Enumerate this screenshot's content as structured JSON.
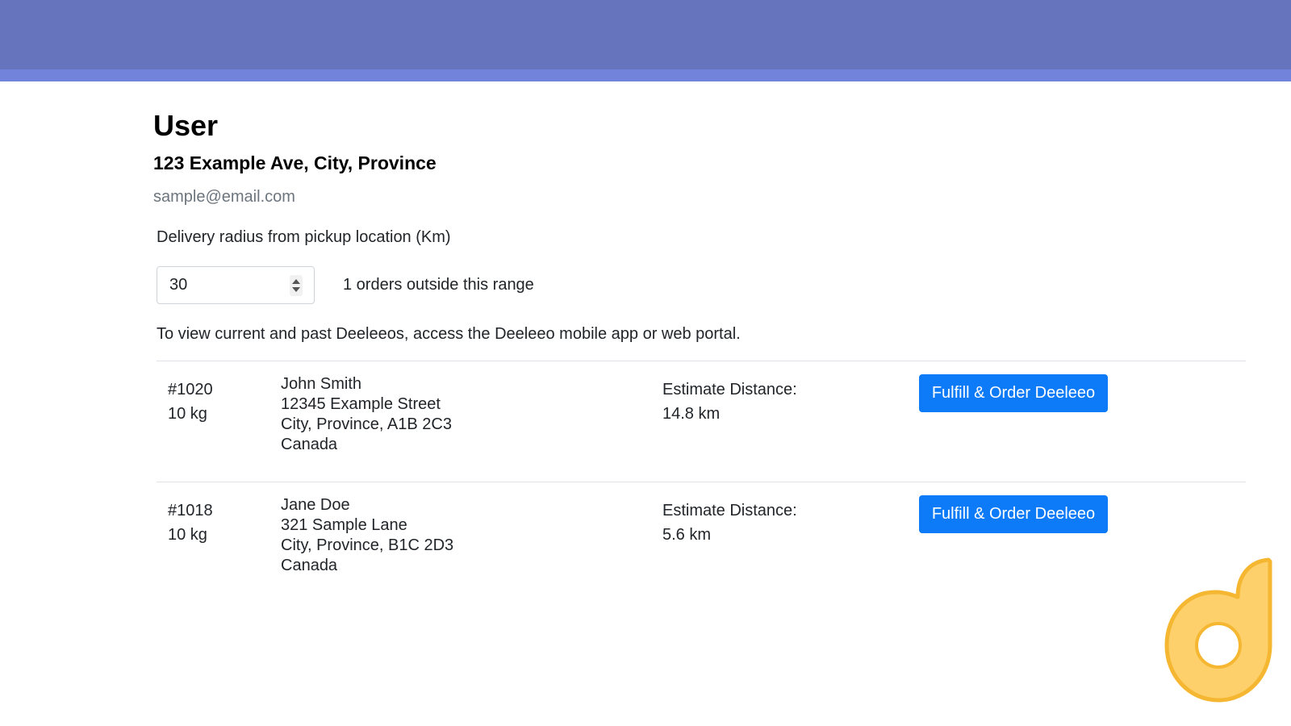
{
  "user": {
    "title": "User",
    "address": "123 Example Ave, City, Province",
    "email": "sample@email.com"
  },
  "delivery": {
    "radius_label": "Delivery radius from pickup location (Km)",
    "radius_value": "30",
    "outside_range_text": "1 orders outside this range",
    "info_text": "To view current and past Deeleeos, access the Deeleeo mobile app or web portal."
  },
  "orders": [
    {
      "id": "#1020",
      "weight": "10 kg",
      "name": "John Smith",
      "street": "12345 Example Street",
      "city_line": "City, Province, A1B 2C3",
      "country": "Canada",
      "distance_label": "Estimate Distance:",
      "distance_value": "14.8 km",
      "button_label": "Fulfill & Order Deeleeo"
    },
    {
      "id": "#1018",
      "weight": "10 kg",
      "name": "Jane Doe",
      "street": "321 Sample Lane",
      "city_line": "City, Province, B1C 2D3",
      "country": "Canada",
      "distance_label": "Estimate Distance:",
      "distance_value": "5.6 km",
      "button_label": "Fulfill & Order Deeleeo"
    }
  ],
  "colors": {
    "header": "#6673bd",
    "header_strip": "#7283dc",
    "button": "#0d7bf7",
    "logo_fill": "#fdd06b",
    "logo_stroke": "#f5b731"
  },
  "icons": {
    "logo": "deeleeo-logo-icon",
    "spinner": "number-spinner-icon"
  }
}
